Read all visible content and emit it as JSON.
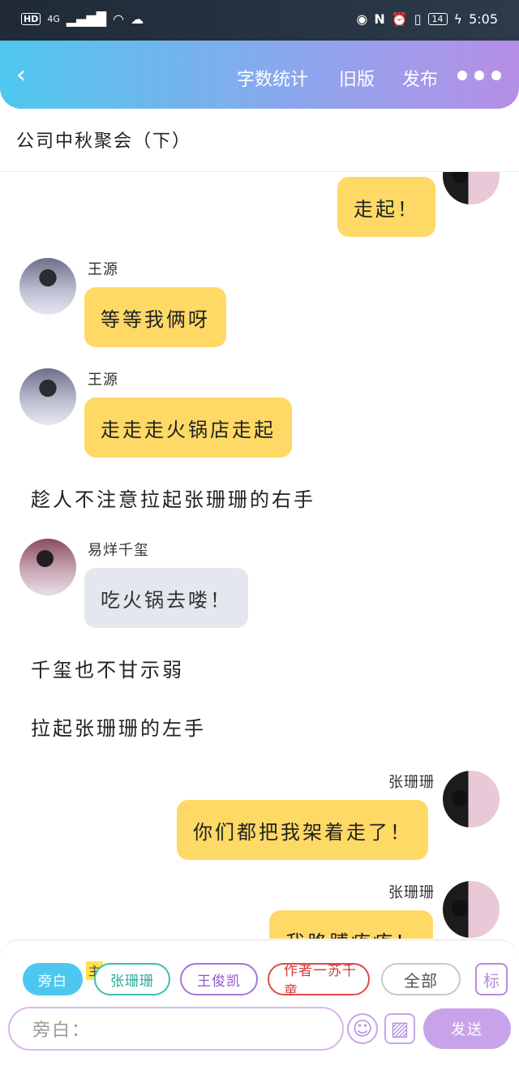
{
  "status_bar": {
    "hd": "HD",
    "network": "4G",
    "battery": "14",
    "time": "5:05"
  },
  "header": {
    "back_icon": "chevron-left-icon",
    "word_count": "字数统计",
    "old_version": "旧版",
    "publish": "发布",
    "more_icon": "more-dots-icon"
  },
  "title": "公司中秋聚会（下）",
  "messages": [
    {
      "type": "right",
      "name": "",
      "text": "走起！"
    },
    {
      "type": "left",
      "name": "王源",
      "text": "等等我俩呀"
    },
    {
      "type": "left",
      "name": "王源",
      "text": "走走走火锅店走起"
    },
    {
      "type": "narration",
      "text": "趁人不注意拉起张珊珊的右手"
    },
    {
      "type": "left",
      "name": "易烊千玺",
      "text": "吃火锅去喽！"
    },
    {
      "type": "narration",
      "text": "千玺也不甘示弱"
    },
    {
      "type": "narration",
      "text": "拉起张珊珊的左手"
    },
    {
      "type": "right",
      "name": "张珊珊",
      "text": "你们都把我架着走了！"
    },
    {
      "type": "right",
      "name": "张珊珊",
      "text": "我胳膊疼疼！"
    }
  ],
  "roles": {
    "narration": "旁白",
    "main_tag": "主",
    "zhang": "张珊珊",
    "wang": "王俊凯",
    "author": "作者一苏千童",
    "all": "全部",
    "mark": "标"
  },
  "input": {
    "placeholder": "旁白：",
    "send": "发送",
    "emoji_icon": "emoji-icon",
    "image_icon": "image-icon"
  },
  "colors": {
    "accent_blue": "#4ec8ef",
    "accent_purple": "#b68ee6",
    "bubble_yellow": "#ffd966",
    "bubble_grey": "#e4e7ee"
  }
}
